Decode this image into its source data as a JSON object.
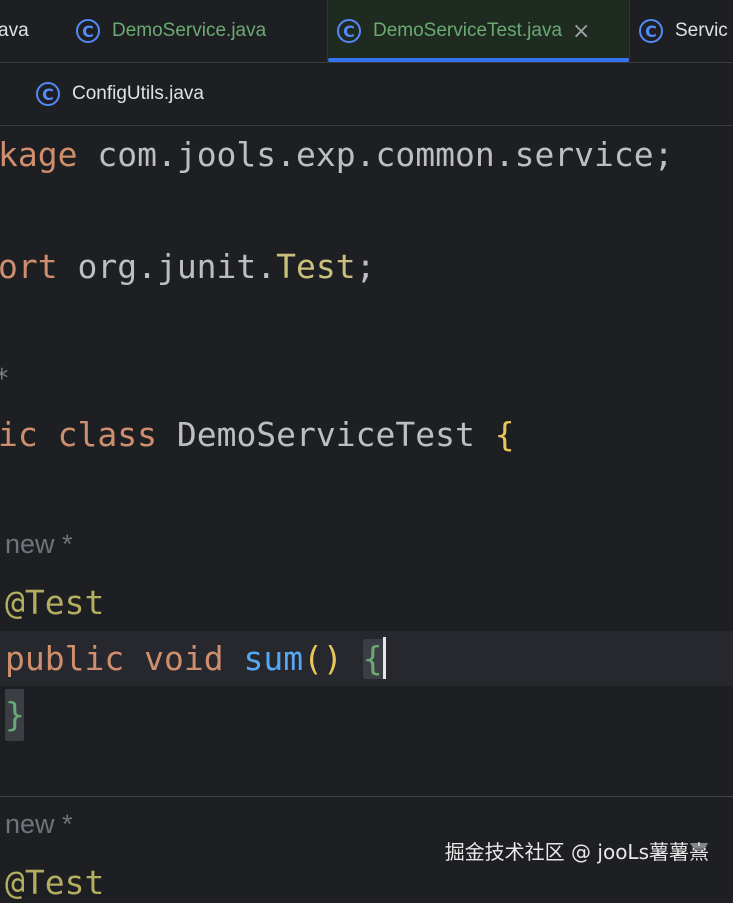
{
  "tabs_row1": [
    {
      "label": "ava",
      "icon": "class-icon",
      "active": false
    },
    {
      "label": "DemoService.java",
      "icon": "class-icon",
      "active": false
    },
    {
      "label": "DemoServiceTest.java",
      "icon": "class-icon",
      "active": true,
      "close": "×"
    },
    {
      "label": "Servic",
      "icon": "class-icon",
      "active": false
    }
  ],
  "tabs_row2": [
    {
      "label": "ConfigUtils.java",
      "icon": "class-icon"
    }
  ],
  "icon_glyph": "C",
  "code": {
    "line1": {
      "kw": "kage",
      "rest": " com.jools.exp.common.service;"
    },
    "line2": {
      "kw": "ort",
      "pkg": " org.junit.",
      "type": "Test",
      "semi": ";"
    },
    "line3": {
      "text": "*"
    },
    "line4": {
      "kw1": "ic",
      "kw2": "class",
      "name": " DemoServiceTest ",
      "brace": "{"
    },
    "hint1": "new *",
    "line5": {
      "annotation": "@Test"
    },
    "line6": {
      "kw1": "public",
      "kw2": "void",
      "fn": "sum",
      "parens": "()",
      "brace": "{"
    },
    "line7": {
      "brace": "}"
    },
    "hint2": "new *",
    "line8": {
      "annotation": "@Test"
    }
  },
  "watermark": "掘金技术社区 @ jooLs薯薯熹",
  "colors": {
    "background": "#1e1f22",
    "keyword": "#cf8e6d",
    "function": "#56a8f5",
    "annotation": "#b3ae60",
    "active_tab_underline": "#3574f0",
    "modified_tab_text": "#6aab73"
  }
}
